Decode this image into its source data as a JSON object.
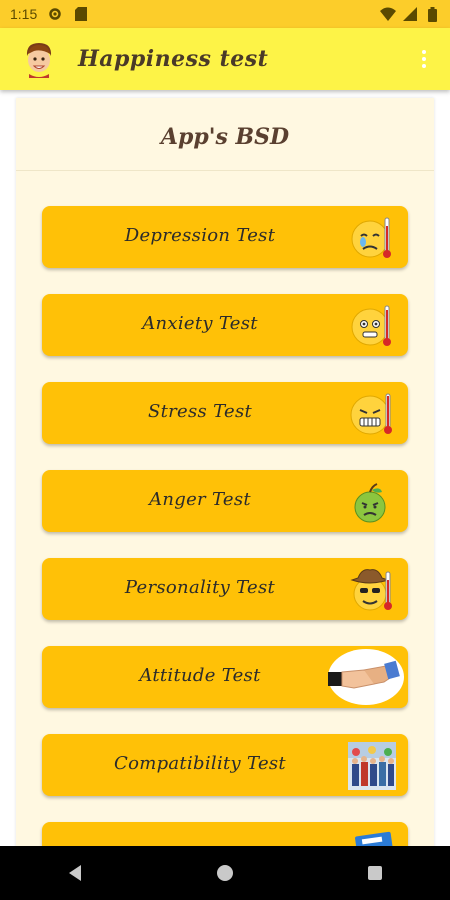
{
  "status_bar": {
    "time": "1:15"
  },
  "app_bar": {
    "title": "Happiness test"
  },
  "card": {
    "title": "App's BSD"
  },
  "tests": [
    {
      "label": "Depression Test",
      "icon": "sad-thermometer-emoji-icon"
    },
    {
      "label": "Anxiety Test",
      "icon": "anxious-thermometer-emoji-icon"
    },
    {
      "label": "Stress Test",
      "icon": "stressed-thermometer-emoji-icon"
    },
    {
      "label": "Anger Test",
      "icon": "angry-apple-icon"
    },
    {
      "label": "Personality Test",
      "icon": "cowboy-emoji-icon"
    },
    {
      "label": "Attitude Test",
      "icon": "handshake-icon"
    },
    {
      "label": "Compatibility Test",
      "icon": "group-photo-icon"
    },
    {
      "label": "",
      "icon": "ticket-icon"
    }
  ],
  "colors": {
    "status_bar": "#fccd2a",
    "app_bar": "#fdf347",
    "card_bg": "#fff8e1",
    "button": "#ffc107",
    "nav_bar": "#000000"
  }
}
